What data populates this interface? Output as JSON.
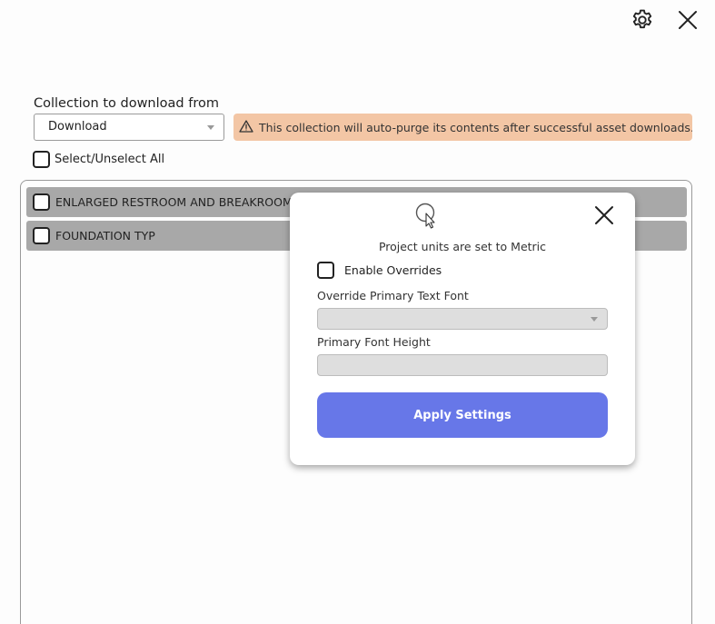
{
  "header": {
    "settings_icon": "gear-icon",
    "close_icon": "close-icon"
  },
  "collection": {
    "label": "Collection to download from",
    "selected": "Download",
    "warning": "This collection will auto-purge its contents after successful asset downloads.",
    "warning_icon": "warning-triangle-icon",
    "warning_color": "#f3c6a5"
  },
  "select_all": {
    "label": "Select/Unselect All",
    "checked": false
  },
  "items": [
    {
      "label": "ENLARGED RESTROOM AND BREAKROOM",
      "checked": false
    },
    {
      "label": "FOUNDATION TYP",
      "checked": false
    }
  ],
  "modal": {
    "units_text": "Project units are set to Metric",
    "enable_overrides_label": "Enable Overrides",
    "enable_overrides_checked": false,
    "font_label": "Override Primary Text Font",
    "font_value": "",
    "height_label": "Primary Font Height",
    "height_value": "",
    "apply_label": "Apply Settings",
    "apply_color": "#6777e8",
    "close_icon": "close-icon"
  }
}
